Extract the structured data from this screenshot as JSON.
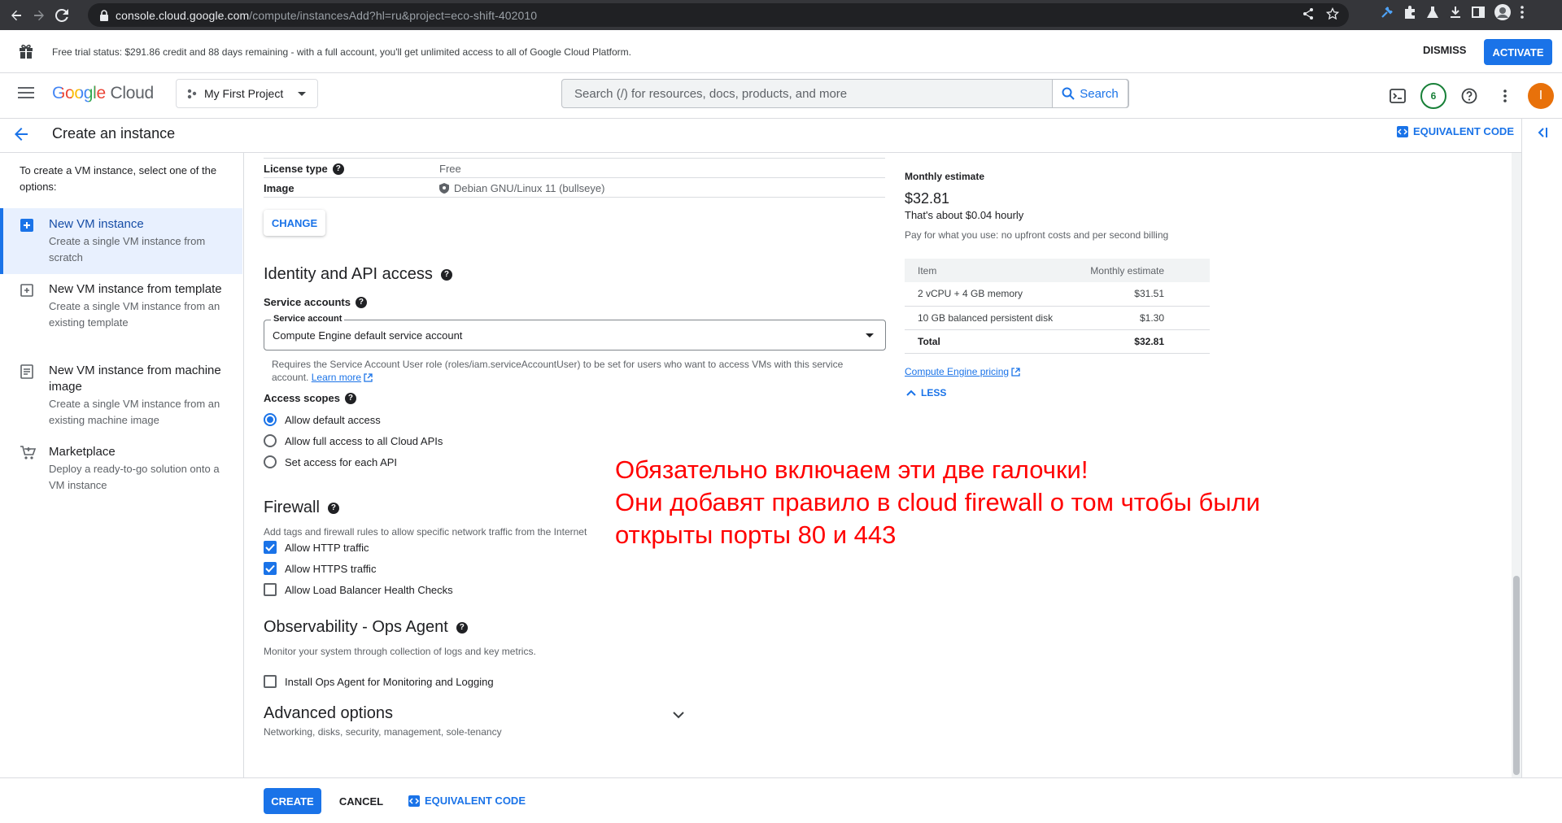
{
  "browser": {
    "url_host": "console.cloud.google.com",
    "url_path": "/compute/instancesAdd?hl=ru&project=eco-shift-402010"
  },
  "banner": {
    "text": "Free trial status: $291.86 credit and 88 days remaining - with a full account, you'll get unlimited access to all of Google Cloud Platform.",
    "dismiss": "DISMISS",
    "activate": "ACTIVATE"
  },
  "header": {
    "logo_google": "Google",
    "logo_cloud": "Cloud",
    "project": "My First Project",
    "search_placeholder": "Search (/) for resources, docs, products, and more",
    "search_button": "Search",
    "notifications": "6",
    "avatar": "I"
  },
  "titlebar": {
    "title": "Create an instance",
    "equivalent_code": "EQUIVALENT CODE"
  },
  "leftnav": {
    "intro": "To create a VM instance, select one of the options:",
    "options": [
      {
        "title": "New VM instance",
        "desc": "Create a single VM instance from scratch",
        "icon": "add-box-icon"
      },
      {
        "title": "New VM instance from template",
        "desc": "Create a single VM instance from an existing template",
        "icon": "template-icon"
      },
      {
        "title": "New VM instance from machine image",
        "desc": "Create a single VM instance from an existing machine image",
        "icon": "machine-image-icon"
      },
      {
        "title": "Marketplace",
        "desc": "Deploy a ready-to-go solution onto a VM instance",
        "icon": "cart-icon"
      }
    ]
  },
  "bootdisk": {
    "license_label": "License type",
    "license_value": "Free",
    "image_label": "Image",
    "image_value": "Debian GNU/Linux 11 (bullseye)",
    "change": "CHANGE"
  },
  "identity": {
    "heading": "Identity and API access",
    "service_accounts_label": "Service accounts",
    "service_account_field_label": "Service account",
    "service_account_value": "Compute Engine default service account",
    "note": "Requires the Service Account User role (roles/iam.serviceAccountUser) to be set for users who want to access VMs with this service account.",
    "learn_more": "Learn more",
    "access_scopes_label": "Access scopes",
    "scopes": [
      {
        "label": "Allow default access",
        "selected": true
      },
      {
        "label": "Allow full access to all Cloud APIs",
        "selected": false
      },
      {
        "label": "Set access for each API",
        "selected": false
      }
    ]
  },
  "firewall": {
    "heading": "Firewall",
    "desc": "Add tags and firewall rules to allow specific network traffic from the Internet",
    "options": [
      {
        "label": "Allow HTTP traffic",
        "checked": true
      },
      {
        "label": "Allow HTTPS traffic",
        "checked": true
      },
      {
        "label": "Allow Load Balancer Health Checks",
        "checked": false
      }
    ]
  },
  "observability": {
    "heading": "Observability - Ops Agent",
    "desc": "Monitor your system through collection of logs and key metrics.",
    "install_label": "Install Ops Agent for Monitoring and Logging",
    "install_checked": false
  },
  "advanced": {
    "title": "Advanced options",
    "subtitle": "Networking, disks, security, management, sole-tenancy"
  },
  "annotation": {
    "line1": "Обязательно включаем эти две галочки!",
    "line2": "Они добавят правило в cloud firewall о том чтобы были открыты порты 80 и 443"
  },
  "estimate": {
    "label": "Monthly estimate",
    "price": "$32.81",
    "hourly": "That's about $0.04 hourly",
    "pay_note": "Pay for what you use: no upfront costs and per second billing",
    "col_item": "Item",
    "col_monthly": "Monthly estimate",
    "rows": [
      {
        "item": "2 vCPU + 4 GB memory",
        "cost": "$31.51"
      },
      {
        "item": "10 GB balanced persistent disk",
        "cost": "$1.30"
      },
      {
        "item": "Total",
        "cost": "$32.81"
      }
    ],
    "pricing_link": "Compute Engine pricing",
    "less": "LESS"
  },
  "footer": {
    "create": "CREATE",
    "cancel": "CANCEL",
    "equivalent_code": "EQUIVALENT CODE"
  },
  "colors": {
    "primary": "#1a73e8",
    "annotation": "#ff0000",
    "chrome_dark": "#35363a"
  }
}
